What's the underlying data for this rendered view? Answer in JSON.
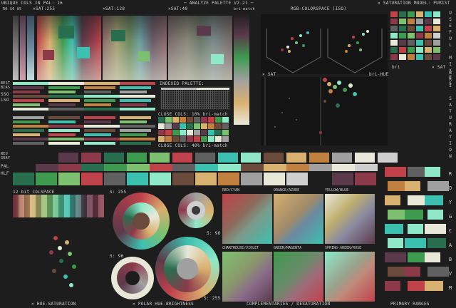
{
  "header": {
    "unique_cols": "UNIQUE COLS IN PAL: 16",
    "title": "─ ANALYZE PALETTE V2.21 ─",
    "saturation_model": "× SATURATION MODEL: PURIST"
  },
  "sat_labels": {
    "small": "R0 S0 85",
    "sat255": "×SAT:255",
    "sat128": "×SAT:128",
    "sat40": "×SAT:40",
    "bri_match": "bri-match",
    "rgb_colorspace": "RGB-COLORSPACE (ISO)"
  },
  "side_labels": {
    "best_bias": "BEST\nBIAS",
    "sso": "SSO",
    "lso": "LSO",
    "neu_gray": "NEU\nGRAY",
    "pal": "PAL",
    "hlf": "HLF"
  },
  "indexed_palette": {
    "title": "INDEXED PALETTE:",
    "close10": "CLOSE COLS: 10% bri-match",
    "close40": "CLOSE COLS: 40% bri-match"
  },
  "scatter": {
    "sat_label": "× SAT",
    "bri_hue": "bri-HUE",
    "bri": "bri",
    "sat_right": "× SAT"
  },
  "vertical_labels": {
    "useful_mixes": "USEFUL MIXES",
    "bri_saturation": "BRI SATURATION",
    "color_letters": [
      "R",
      "O",
      "Y",
      "G",
      "C",
      "A",
      "B",
      "V",
      "M"
    ]
  },
  "colspace": {
    "title": "12 bit COLSPACE",
    "s255a": "S: 255",
    "s96a": "S: 96",
    "s96b": "S: 96",
    "s255b": "S: 255"
  },
  "hue_pairs": [
    "RED/CYAN",
    "ORANGE/AZURE",
    "YELLOW/BLUE",
    "CHARTREUSE/VIOLET",
    "GREEN/MAGENTA",
    "SPRING-GREEN/ROSE"
  ],
  "footer": {
    "hue_sat": "× HUE-SATURATION",
    "polar": "× POLAR HUE-BRIGHTNESS",
    "complementaries": "COMPLEMENTARIES / DESATURATION",
    "primary_ranges": "PRIMARY RANGES"
  },
  "palette": [
    "#1d1d1d",
    "#5a3a4a",
    "#8c3a4a",
    "#c0424a",
    "#2a6e50",
    "#3e9a4e",
    "#7cc070",
    "#3cc0b0",
    "#8fe8c8",
    "#e8e8d8",
    "#d8b070",
    "#c08040",
    "#6a4a3a",
    "#606060",
    "#a0a0a0",
    "#cfcfcf"
  ]
}
